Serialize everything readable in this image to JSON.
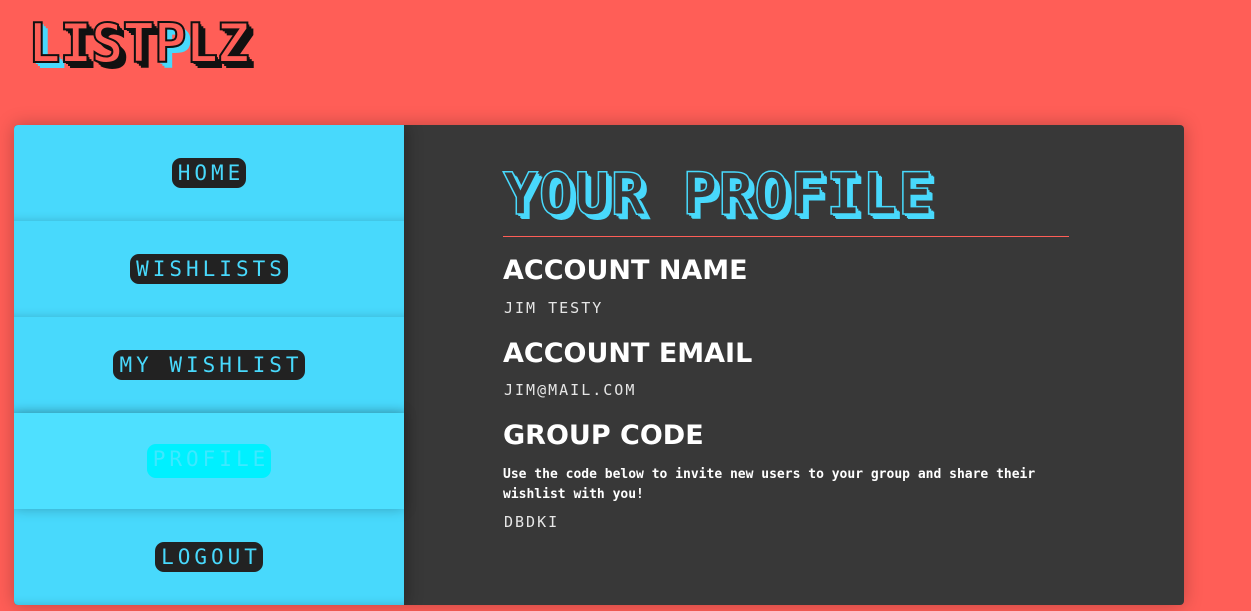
{
  "logo": {
    "letters": [
      {
        "char": "L",
        "style": "blue"
      },
      {
        "char": "I",
        "style": "red"
      },
      {
        "char": "S",
        "style": "red"
      },
      {
        "char": "T",
        "style": "red"
      },
      {
        "char": "P",
        "style": "blue"
      },
      {
        "char": "L",
        "style": "red"
      },
      {
        "char": "Z",
        "style": "red"
      }
    ]
  },
  "colors": {
    "background": "#ff5e57",
    "sidebar": "#48d9fc",
    "panel": "#383838",
    "accent": "#48d9fc",
    "active_nav": "#00f0ff"
  },
  "nav": {
    "items": [
      {
        "label": "Home",
        "active": false
      },
      {
        "label": "Wishlists",
        "active": false
      },
      {
        "label": "My Wishlist",
        "active": false
      },
      {
        "label": "Profile",
        "active": true
      },
      {
        "label": "Logout",
        "active": false
      }
    ]
  },
  "profile": {
    "title": "Your Profile",
    "account_name_heading": "Account Name",
    "account_name_value": "Jim Testy",
    "account_email_heading": "Account Email",
    "account_email_value": "jim@mail.com",
    "group_code_heading": "Group Code",
    "group_code_description": "Use the code below to invite new users to your group and share their wishlist with you!",
    "group_code_value": "dbdki"
  }
}
